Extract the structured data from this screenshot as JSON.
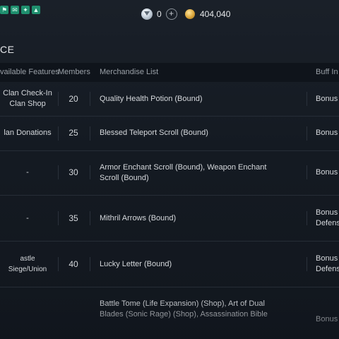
{
  "status_bar": {
    "icons": [
      "clan-status-icon",
      "message-status-icon",
      "event-status-icon",
      "boost-status-icon"
    ]
  },
  "currency": {
    "gem_count": "0",
    "gold_count": "404,040"
  },
  "page": {
    "title": "CE"
  },
  "table": {
    "headers": {
      "features": "vailable Features",
      "members": "Members",
      "merchandise": "Merchandise List",
      "buff": "Buff In"
    },
    "rows": [
      {
        "feature_line1": "Clan Check-In",
        "feature_line2": "Clan Shop",
        "members": "20",
        "merchandise": "Quality Health Potion (Bound)",
        "buff_line1": "Bonus",
        "buff_line2": ""
      },
      {
        "feature_line1": "lan Donations",
        "feature_line2": "",
        "members": "25",
        "merchandise": "Blessed Teleport Scroll (Bound)",
        "buff_line1": "Bonus",
        "buff_line2": ""
      },
      {
        "feature_line1": "-",
        "feature_line2": "",
        "members": "30",
        "merchandise": "Armor Enchant Scroll (Bound), Weapon Enchant Scroll (Bound)",
        "buff_line1": "Bonus",
        "buff_line2": ""
      },
      {
        "feature_line1": "-",
        "feature_line2": "",
        "members": "35",
        "merchandise": "Mithril Arrows (Bound)",
        "buff_line1": "Bonus",
        "buff_line2": "Defens"
      },
      {
        "feature_line1": "astle Siege/Union",
        "feature_line2": "",
        "members": "40",
        "merchandise": "Lucky Letter (Bound)",
        "buff_line1": "Bonus",
        "buff_line2": "Defens"
      },
      {
        "feature_line1": "",
        "feature_line2": "",
        "members": "",
        "merchandise": "Battle Tome (Life Expansion) (Shop), Art of Dual Blades (Sonic Rage) (Shop), Assassination Bible",
        "buff_line1": "Bonus",
        "buff_line2": ""
      }
    ]
  }
}
